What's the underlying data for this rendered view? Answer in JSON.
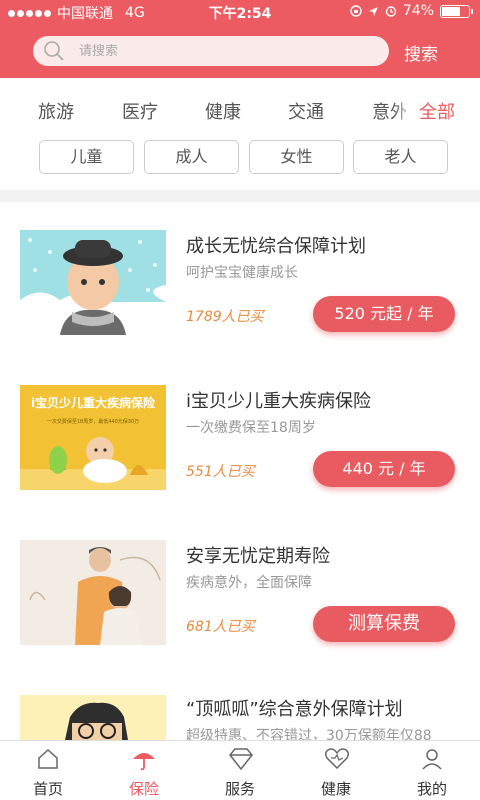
{
  "status_bar": {
    "carrier": "中国联通",
    "network": "4G",
    "time": "下午2:54",
    "battery": "74%",
    "battery_level": 0.74
  },
  "search": {
    "placeholder": "请搜索",
    "button_label": "搜索"
  },
  "categories": [
    "旅游",
    "医疗",
    "健康",
    "交通",
    "意外"
  ],
  "category_all": "全部",
  "audience": [
    "儿童",
    "成人",
    "女性",
    "老人"
  ],
  "products": [
    {
      "title": "成长无忧综合保障计划",
      "desc": "呵护宝宝健康成长",
      "buyers": "1789人已买",
      "price": "520 元起 / 年"
    },
    {
      "title": "i宝贝少儿重大疾病保险",
      "desc": "一次缴费保至18周岁",
      "buyers": "551人已买",
      "price": "440 元 / 年",
      "banner_title": "i宝贝少儿重大疾病保险",
      "banner_sub": "一次交费保至18周岁，最低440元保30万"
    },
    {
      "title": "安享无忧定期寿险",
      "desc": "疾病意外，全面保障",
      "buyers": "681人已买",
      "price": "测算保费"
    },
    {
      "title": "“顶呱呱”综合意外保障计划",
      "desc": "超级特惠、不容错过，30万保额年仅88"
    }
  ],
  "tabbar": [
    {
      "label": "首页",
      "icon": "home-icon"
    },
    {
      "label": "保险",
      "icon": "umbrella-icon"
    },
    {
      "label": "服务",
      "icon": "diamond-icon"
    },
    {
      "label": "健康",
      "icon": "heart-icon"
    },
    {
      "label": "我的",
      "icon": "person-icon"
    }
  ],
  "colors": {
    "accent": "#ec5b61",
    "price_button": "#e85c61",
    "buyers_text": "#e98a3c"
  }
}
